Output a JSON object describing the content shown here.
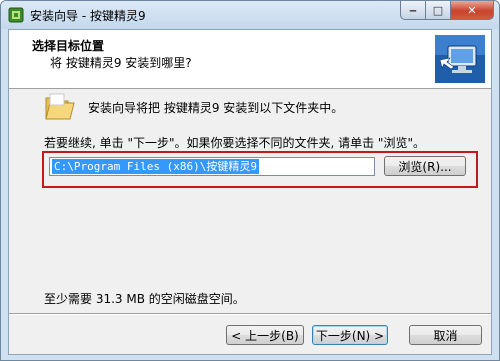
{
  "window": {
    "title": "安装向导 - 按键精灵9"
  },
  "titlebar_buttons": {
    "minimize": "‒",
    "maximize": "□",
    "close": "✕"
  },
  "header": {
    "title": "选择目标位置",
    "subtitle": "将 按键精灵9 安装到哪里?"
  },
  "body": {
    "install_line": "安装向导将把 按键精灵9 安装到以下文件夹中。",
    "instruction": "若要继续, 单击 \"下一步\"。如果你要选择不同的文件夹, 请单击 \"浏览\"。",
    "install_path": "C:\\Program Files (x86)\\按键精灵9",
    "browse_label": "浏览(R)...",
    "space_required": "至少需要 31.3 MB 的空闲磁盘空间。"
  },
  "footer": {
    "back_label": "< 上一步(B)",
    "next_label": "下一步(N) >",
    "cancel_label": "取消"
  },
  "colors": {
    "highlight_box": "#c4191c",
    "selection": "#3399ff"
  }
}
